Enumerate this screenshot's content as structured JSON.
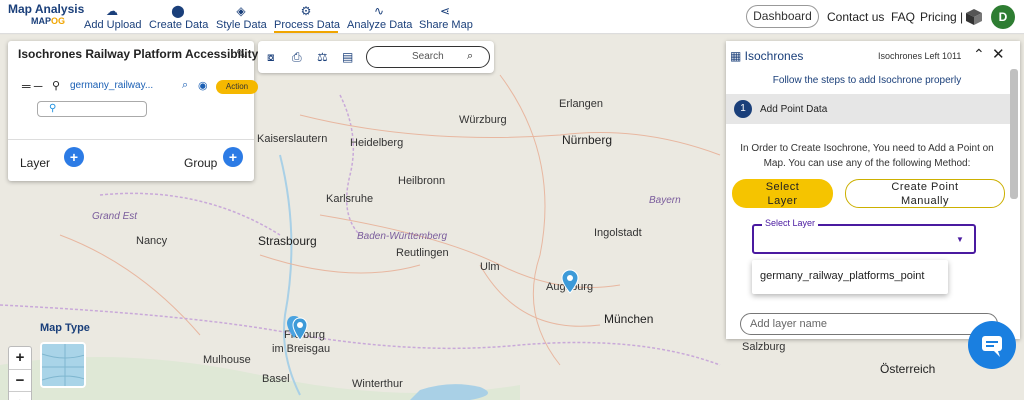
{
  "brand": {
    "line1": "Map Analysis",
    "line2_a": "MAP",
    "line2_b": "OG"
  },
  "nav": [
    {
      "label": "Add Upload",
      "icon": "cloud-upload-icon"
    },
    {
      "label": "Create Data",
      "icon": "map-pin-icon"
    },
    {
      "label": "Style Data",
      "icon": "paint-bucket-icon"
    },
    {
      "label": "Process Data",
      "icon": "process-icon"
    },
    {
      "label": "Analyze Data",
      "icon": "analyze-icon"
    },
    {
      "label": "Share Map",
      "icon": "share-icon"
    }
  ],
  "topright": {
    "dashboard": "Dashboard",
    "contact": "Contact us",
    "faq": "FAQ",
    "pricing": "Pricing |",
    "avatar": "D"
  },
  "layer_panel": {
    "title": "Isochrones Railway Platform Accessibility",
    "layer_name": "germany_railway...",
    "action": "Action",
    "layer_label": "Layer",
    "group_label": "Group"
  },
  "toolbar": {
    "search": "Search"
  },
  "iso": {
    "title": "Isochrones",
    "left": "Isochrones Left 1011",
    "instruction": "Follow the steps to add Isochrone properly",
    "step_num": "1",
    "step_title": "Add Point Data",
    "desc": "In Order to Create Isochrone, You need to Add a Point on Map. You can use any of the following Method:",
    "btn_select_1": "Select",
    "btn_select_2": "Layer",
    "btn_manual_1": "Create Point",
    "btn_manual_2": "Manually",
    "select_legend": "Select Layer",
    "option": "germany_railway_platforms_point",
    "add_name_placeholder": "Add layer name"
  },
  "map": {
    "map_type": "Map Type",
    "places": [
      "Würzburg",
      "Erlangen",
      "Nürnberg",
      "Kaiserslautern",
      "Heidelberg",
      "Heilbronn",
      "Karlsruhe",
      "Bayern",
      "Grand Est",
      "Nancy",
      "Strasbourg",
      "Baden-Württemberg",
      "Ingolstadt",
      "Reutlingen",
      "Ulm",
      "Augsburg",
      "München",
      "Freiburg",
      "im Breisgau",
      "Mulhouse",
      "Basel",
      "Winterthur",
      "Salzburg",
      "Österreich"
    ]
  },
  "colors": {
    "accent": "#f5c400",
    "brand": "#1a3f7a",
    "primary": "#2c7be5"
  }
}
